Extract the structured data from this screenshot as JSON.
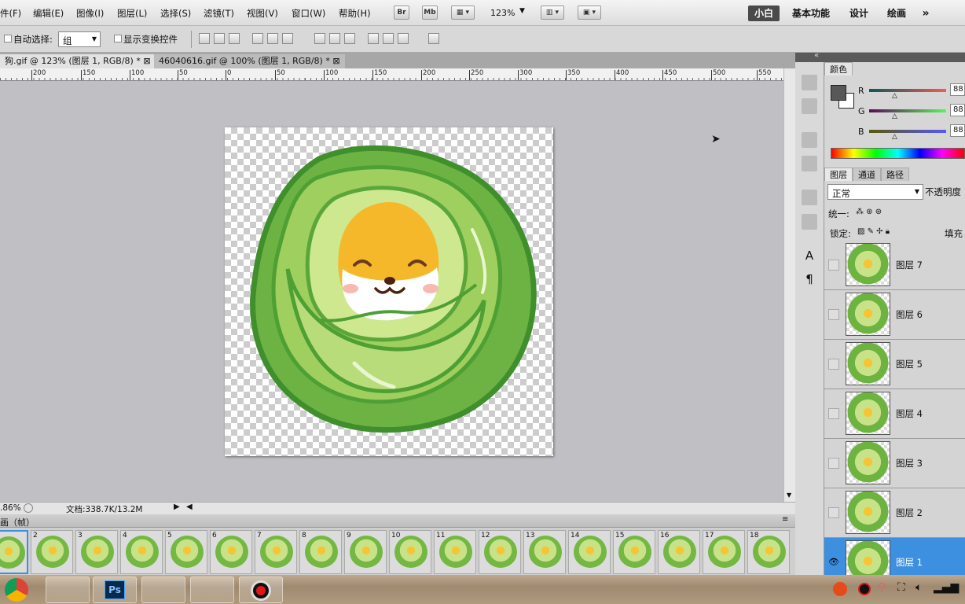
{
  "menu": [
    "件(F)",
    "编辑(E)",
    "图像(I)",
    "图层(L)",
    "选择(S)",
    "滤镜(T)",
    "视图(V)",
    "窗口(W)",
    "帮助(H)"
  ],
  "menubar": {
    "br": "Br",
    "mb": "Mb",
    "zoom": "123%"
  },
  "workspaces": [
    "小白",
    "基本功能",
    "设计",
    "绘画",
    "»"
  ],
  "options": {
    "auto_select_label": "自动选择:",
    "auto_select_value": "组",
    "show_transform_label": "显示变换控件"
  },
  "tabs": [
    {
      "label": "狗.gif @ 123% (图层 1, RGB/8) *",
      "close": "⊠"
    },
    {
      "label": "46040616.gif @ 100% (图层 1, RGB/8) *",
      "close": "⊠"
    }
  ],
  "ruler": {
    "labels": [
      "200",
      "150",
      "100",
      "50",
      "0",
      "50",
      "100",
      "150",
      "200",
      "250",
      "300",
      "350",
      "400",
      "450",
      "500",
      "550"
    ]
  },
  "status": {
    "zoom": ".86%",
    "doc": "文档:338.7K/13.2M"
  },
  "animation": {
    "title": "画（帧）",
    "frames": [
      "",
      "2",
      "3",
      "4",
      "5",
      "6",
      "7",
      "8",
      "9",
      "10",
      "11",
      "12",
      "13",
      "14",
      "15",
      "16",
      "17",
      "18"
    ]
  },
  "color_panel": {
    "tab": "颜色",
    "r_label": "R",
    "g_label": "G",
    "b_label": "B",
    "r": "88",
    "g": "88",
    "b": "88"
  },
  "layers_panel": {
    "tabs": [
      "图层",
      "通道",
      "路径"
    ],
    "blend_mode": "正常",
    "opacity_label": "不透明度",
    "unify_label": "统一:",
    "lock_label": "锁定:",
    "fill_label": "填充"
  },
  "layers": [
    {
      "name": "图层 7"
    },
    {
      "name": "图层 6"
    },
    {
      "name": "图层 5"
    },
    {
      "name": "图层 4"
    },
    {
      "name": "图层 3"
    },
    {
      "name": "图层 2"
    },
    {
      "name": "图层 1",
      "selected": true
    }
  ],
  "taskbar": {
    "ps_label": "Ps"
  },
  "colors": {
    "selection": "#3d8fe0",
    "workspace_bg": "#c0bfc4",
    "cabbage_dark": "#5aa63a",
    "cabbage_light": "#b9dc7a",
    "shiba": "#f5b82a"
  }
}
